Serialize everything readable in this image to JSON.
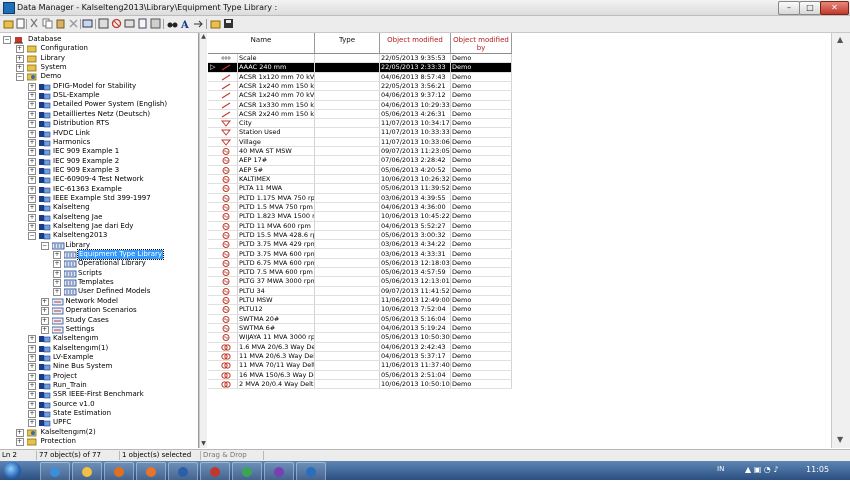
{
  "window": {
    "title": "Data Manager - Kalselteng2013\\Library\\Equipment Type Library :",
    "minimize": "–",
    "maximize": "□",
    "close": "✕"
  },
  "toolbar": {
    "icons": [
      "new-folder-icon",
      "new-object-icon",
      "cut-icon",
      "copy-icon",
      "paste-icon",
      "delete-icon",
      "edit-icon",
      "filter-icon",
      "stop-icon",
      "tools-icon",
      "report-icon",
      "settings-icon",
      "binoculars-icon",
      "font-icon",
      "move-icon",
      "open-folder-icon",
      "save-icon"
    ]
  },
  "tree": {
    "items": [
      {
        "label": "Database",
        "depth": 0,
        "exp": "−",
        "icon": "database"
      },
      {
        "label": "Configuration",
        "depth": 1,
        "exp": "+",
        "icon": "folder"
      },
      {
        "label": "Library",
        "depth": 1,
        "exp": "+",
        "icon": "folder"
      },
      {
        "label": "System",
        "depth": 1,
        "exp": "+",
        "icon": "folder"
      },
      {
        "label": "Demo",
        "depth": 1,
        "exp": "−",
        "icon": "user"
      },
      {
        "label": "DFIG-Model for Stability",
        "depth": 2,
        "exp": "+",
        "icon": "project"
      },
      {
        "label": "DSL-Example",
        "depth": 2,
        "exp": "+",
        "icon": "project"
      },
      {
        "label": "Detailed Power System (English)",
        "depth": 2,
        "exp": "+",
        "icon": "project"
      },
      {
        "label": "Detailliertes Netz (Deutsch)",
        "depth": 2,
        "exp": "+",
        "icon": "project"
      },
      {
        "label": "Distribution RTS",
        "depth": 2,
        "exp": "+",
        "icon": "project"
      },
      {
        "label": "HVDC Link",
        "depth": 2,
        "exp": "+",
        "icon": "project"
      },
      {
        "label": "Harmonics",
        "depth": 2,
        "exp": "+",
        "icon": "project"
      },
      {
        "label": "IEC 909 Example 1",
        "depth": 2,
        "exp": "+",
        "icon": "project"
      },
      {
        "label": "IEC 909 Example 2",
        "depth": 2,
        "exp": "+",
        "icon": "project"
      },
      {
        "label": "IEC 909 Example 3",
        "depth": 2,
        "exp": "+",
        "icon": "project"
      },
      {
        "label": "IEC-60909-4 Test Network",
        "depth": 2,
        "exp": "+",
        "icon": "project"
      },
      {
        "label": "IEC-61363 Example",
        "depth": 2,
        "exp": "+",
        "icon": "project"
      },
      {
        "label": "IEEE Example Std 399-1997",
        "depth": 2,
        "exp": "+",
        "icon": "project"
      },
      {
        "label": "Kalselteng",
        "depth": 2,
        "exp": "+",
        "icon": "project"
      },
      {
        "label": "Kalselteng Jae",
        "depth": 2,
        "exp": "+",
        "icon": "project"
      },
      {
        "label": "Kalselteng Jae dari Edy",
        "depth": 2,
        "exp": "+",
        "icon": "project"
      },
      {
        "label": "Kalselteng2013",
        "depth": 2,
        "exp": "−",
        "icon": "project"
      },
      {
        "label": "Library",
        "depth": 3,
        "exp": "−",
        "icon": "library"
      },
      {
        "label": "Equipment Type Library",
        "depth": 4,
        "exp": "+",
        "icon": "library",
        "selected": true
      },
      {
        "label": "Operational Library",
        "depth": 4,
        "exp": "+",
        "icon": "library"
      },
      {
        "label": "Scripts",
        "depth": 4,
        "exp": "+",
        "icon": "library"
      },
      {
        "label": "Templates",
        "depth": 4,
        "exp": "+",
        "icon": "library"
      },
      {
        "label": "User Defined Models",
        "depth": 4,
        "exp": "+",
        "icon": "library"
      },
      {
        "label": "Network Model",
        "depth": 3,
        "exp": "+",
        "icon": "network"
      },
      {
        "label": "Operation Scenarios",
        "depth": 3,
        "exp": "+",
        "icon": "network"
      },
      {
        "label": "Study Cases",
        "depth": 3,
        "exp": "+",
        "icon": "network"
      },
      {
        "label": "Settings",
        "depth": 3,
        "exp": "+",
        "icon": "network"
      },
      {
        "label": "Kalseltengım",
        "depth": 2,
        "exp": "+",
        "icon": "project"
      },
      {
        "label": "Kalseltengım(1)",
        "depth": 2,
        "exp": "+",
        "icon": "project"
      },
      {
        "label": "LV-Example",
        "depth": 2,
        "exp": "+",
        "icon": "project"
      },
      {
        "label": "Nine Bus System",
        "depth": 2,
        "exp": "+",
        "icon": "project"
      },
      {
        "label": "Project",
        "depth": 2,
        "exp": "+",
        "icon": "project"
      },
      {
        "label": "Run_Train",
        "depth": 2,
        "exp": "+",
        "icon": "project"
      },
      {
        "label": "SSR IEEE-First Benchmark",
        "depth": 2,
        "exp": "+",
        "icon": "project"
      },
      {
        "label": "Source v1.0",
        "depth": 2,
        "exp": "+",
        "icon": "project"
      },
      {
        "label": "State Estimation",
        "depth": 2,
        "exp": "+",
        "icon": "project"
      },
      {
        "label": "UPFC",
        "depth": 2,
        "exp": "+",
        "icon": "project"
      },
      {
        "label": "Kalseltengım(2)",
        "depth": 1,
        "exp": "+",
        "icon": "user"
      },
      {
        "label": "Protection",
        "depth": 1,
        "exp": "+",
        "icon": "folder"
      }
    ]
  },
  "table": {
    "columns": [
      "Name",
      "Type",
      "Object modified",
      "Object modified by"
    ],
    "rows": [
      {
        "name": "Scale",
        "type": "",
        "modified": "22/05/2013 9:35:53",
        "by": "Demo",
        "icon": "scale"
      },
      {
        "name": "AAAC 240 mm",
        "type": "",
        "modified": "22/05/2013 2:33:33",
        "by": "Demo",
        "icon": "line",
        "selected": true
      },
      {
        "name": "ACSR 1x120 mm 70 kV",
        "type": "",
        "modified": "04/06/2013 8:57:43",
        "by": "Demo",
        "icon": "line"
      },
      {
        "name": "ACSR 1x240 mm 150 kV",
        "type": "",
        "modified": "22/05/2013 3:56:21",
        "by": "Demo",
        "icon": "line"
      },
      {
        "name": "ACSR 1x240 mm 70 kV",
        "type": "",
        "modified": "04/06/2013 9:37:12",
        "by": "Demo",
        "icon": "line"
      },
      {
        "name": "ACSR 1x330 mm 150 kV",
        "type": "",
        "modified": "04/06/2013 10:29:33",
        "by": "Demo",
        "icon": "line"
      },
      {
        "name": "ACSR 2x240 mm 150 kV",
        "type": "",
        "modified": "05/06/2013 4:26:31",
        "by": "Demo",
        "icon": "line"
      },
      {
        "name": "City",
        "type": "",
        "modified": "11/07/2013 10:34:17",
        "by": "Demo",
        "icon": "load"
      },
      {
        "name": "Station Used",
        "type": "",
        "modified": "11/07/2013 10:33:33",
        "by": "Demo",
        "icon": "load"
      },
      {
        "name": "Village",
        "type": "",
        "modified": "11/07/2013 10:33:06",
        "by": "Demo",
        "icon": "load"
      },
      {
        "name": "40 MVA ST MSW",
        "type": "",
        "modified": "09/07/2013 11:23:05",
        "by": "Demo",
        "icon": "gen"
      },
      {
        "name": "AEP 17#",
        "type": "",
        "modified": "07/06/2013 2:28:42",
        "by": "Demo",
        "icon": "gen"
      },
      {
        "name": "AEP 5#",
        "type": "",
        "modified": "05/06/2013 4:20:52",
        "by": "Demo",
        "icon": "gen"
      },
      {
        "name": "KALTIMEX",
        "type": "",
        "modified": "10/06/2013 10:26:32",
        "by": "Demo",
        "icon": "gen"
      },
      {
        "name": "PLTA 11 MWA",
        "type": "",
        "modified": "05/06/2013 11:39:52",
        "by": "Demo",
        "icon": "gen"
      },
      {
        "name": "PLTD 1.175 MVA 750 rpm",
        "type": "",
        "modified": "03/06/2013 4:39:55",
        "by": "Demo",
        "icon": "gen"
      },
      {
        "name": "PLTD 1.5 MVA 750 rpm",
        "type": "",
        "modified": "04/06/2013 4:36:00",
        "by": "Demo",
        "icon": "gen"
      },
      {
        "name": "PLTD 1.823 MVA 1500 rpm",
        "type": "",
        "modified": "10/06/2013 10:45:22",
        "by": "Demo",
        "icon": "gen"
      },
      {
        "name": "PLTD 11 MVA 600 rpm",
        "type": "",
        "modified": "04/06/2013 5:52:27",
        "by": "Demo",
        "icon": "gen"
      },
      {
        "name": "PLTD 15.5 MVA 428.6 rpm",
        "type": "",
        "modified": "05/06/2013 3:00:32",
        "by": "Demo",
        "icon": "gen"
      },
      {
        "name": "PLTD 3.75 MVA 429 rpm",
        "type": "",
        "modified": "03/06/2013 4:34:22",
        "by": "Demo",
        "icon": "gen"
      },
      {
        "name": "PLTD 3.75 MVA 600 rpm",
        "type": "",
        "modified": "03/06/2013 4:33:31",
        "by": "Demo",
        "icon": "gen"
      },
      {
        "name": "PLTD 6.75 MVA 600 rpm",
        "type": "",
        "modified": "05/06/2013 12:18:03",
        "by": "Demo",
        "icon": "gen"
      },
      {
        "name": "PLTD 7.5 MVA 600 rpm",
        "type": "",
        "modified": "05/06/2013 4:57:59",
        "by": "Demo",
        "icon": "gen"
      },
      {
        "name": "PLTG 37 MWA 3000 rpm",
        "type": "",
        "modified": "05/06/2013 12:13:01",
        "by": "Demo",
        "icon": "gen"
      },
      {
        "name": "PLTU 34",
        "type": "",
        "modified": "09/07/2013 11:41:52",
        "by": "Demo",
        "icon": "gen"
      },
      {
        "name": "PLTU MSW",
        "type": "",
        "modified": "11/06/2013 12:49:00",
        "by": "Demo",
        "icon": "gen"
      },
      {
        "name": "PLTU12",
        "type": "",
        "modified": "10/06/2013 7:52:04",
        "by": "Demo",
        "icon": "gen"
      },
      {
        "name": "SWTMA 20#",
        "type": "",
        "modified": "05/06/2013 5:16:04",
        "by": "Demo",
        "icon": "gen"
      },
      {
        "name": "SWTMA 6#",
        "type": "",
        "modified": "04/06/2013 5:19:24",
        "by": "Demo",
        "icon": "gen"
      },
      {
        "name": "WIJAYA 11 MVA 3000 rpm",
        "type": "",
        "modified": "05/06/2013 10:50:30",
        "by": "Demo",
        "icon": "gen"
      },
      {
        "name": "1.6 MVA 20/6.3 Way Delta",
        "type": "",
        "modified": "04/06/2013 2:42:43",
        "by": "Demo",
        "icon": "trafo"
      },
      {
        "name": "11 MVA 20/6.3 Way Delta",
        "type": "",
        "modified": "04/06/2013 5:37:17",
        "by": "Demo",
        "icon": "trafo"
      },
      {
        "name": "11 MVA 70/11 Way Delta",
        "type": "",
        "modified": "11/06/2013 11:37:40",
        "by": "Demo",
        "icon": "trafo"
      },
      {
        "name": "16 MVA 150/6.3 Way Delta",
        "type": "",
        "modified": "05/06/2013 2:51:04",
        "by": "Demo",
        "icon": "trafo"
      },
      {
        "name": "2 MVA 20/0.4 Way Delta",
        "type": "",
        "modified": "10/06/2013 10:50:10",
        "by": "Demo",
        "icon": "trafo"
      }
    ]
  },
  "status": {
    "line": "Ln 2",
    "objects": "77 object(s) of 77",
    "selected": "1 object(s) selected",
    "mode": "Drag & Drop"
  },
  "taskbar": {
    "apps": [
      "internet-explorer-icon",
      "file-explorer-icon",
      "media-player-icon",
      "firefox-icon",
      "word-icon",
      "powerfactory-icon",
      "chrome-icon",
      "screen-recorder-icon",
      "powerfactory-app-icon"
    ],
    "language": "IN",
    "time": "11:05"
  },
  "colors": {
    "selection_tree": "#3399ff",
    "selection_row": "#000000",
    "taskbar": "#2b4f80"
  }
}
